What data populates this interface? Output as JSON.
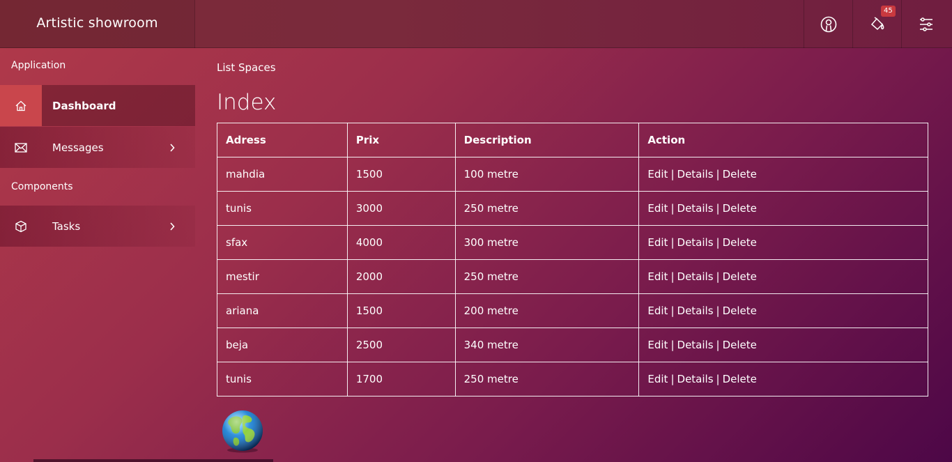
{
  "header": {
    "brand": "Artistic showroom",
    "notification_count": "45",
    "icons": [
      "user-circle-icon",
      "paint-bucket-icon",
      "sliders-icon"
    ]
  },
  "sidebar": {
    "section_application": "Application",
    "section_components": "Components",
    "items": [
      {
        "label": "Dashboard",
        "icon": "home-icon"
      },
      {
        "label": "Messages",
        "icon": "envelope-icon"
      },
      {
        "label": "Tasks",
        "icon": "box-icon"
      }
    ]
  },
  "main": {
    "breadcrumb": "List Spaces",
    "title": "Index",
    "table": {
      "headers": [
        "Adress",
        "Prix",
        "Description",
        "Action"
      ],
      "rows": [
        {
          "adress": "mahdia",
          "prix": "1500",
          "description": "100 metre"
        },
        {
          "adress": "tunis",
          "prix": "3000",
          "description": "250 metre"
        },
        {
          "adress": "sfax",
          "prix": "4000",
          "description": "300 metre"
        },
        {
          "adress": "mestir",
          "prix": "2000",
          "description": "250 metre"
        },
        {
          "adress": "ariana",
          "prix": "1500",
          "description": "200 metre"
        },
        {
          "adress": "beja",
          "prix": "2500",
          "description": "340 metre"
        },
        {
          "adress": "tunis",
          "prix": "1700",
          "description": "250 metre"
        }
      ],
      "actions": {
        "edit": "Edit",
        "details": "Details",
        "delete": "Delete",
        "separator": "|"
      }
    }
  },
  "colors": {
    "accent": "#c9464c",
    "badge": "#c9393f",
    "text": "#ffffff"
  }
}
